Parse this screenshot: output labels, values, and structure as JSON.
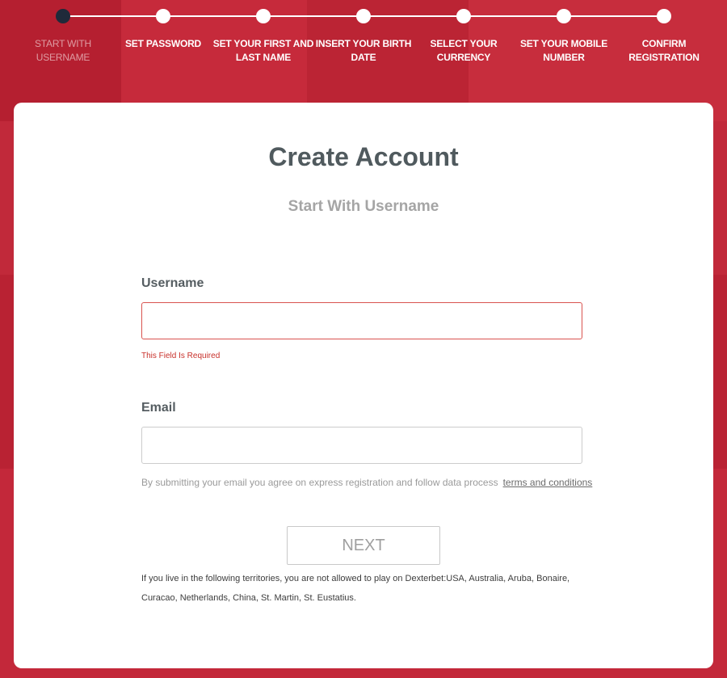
{
  "steps": [
    {
      "label": "Start With Username",
      "active": true
    },
    {
      "label": "Set Password",
      "active": false
    },
    {
      "label": "Set Your First And Last Name",
      "active": false
    },
    {
      "label": "Insert Your Birth Date",
      "active": false
    },
    {
      "label": "Select Your Currency",
      "active": false
    },
    {
      "label": "Set Your Mobile Number",
      "active": false
    },
    {
      "label": "Confirm Registration",
      "active": false
    }
  ],
  "form": {
    "title": "Create Account",
    "subtitle": "Start With Username",
    "username": {
      "label": "Username",
      "value": "",
      "error": "This Field Is Required"
    },
    "email": {
      "label": "Email",
      "value": ""
    },
    "consent_text": "By submitting your email you agree on express registration and follow data process",
    "terms_link": "terms and conditions",
    "next_label": "NEXT",
    "territory_notice": "If you live in the following territories, you are not allowed to play on Dexterbet:USA, Australia, Aruba, Bonaire, Curacao, Netherlands, China, St. Martin, St. Eustatius."
  },
  "colors": {
    "background": "#c8283a",
    "active_step": "#1f2a3a",
    "error": "#c8302a"
  }
}
